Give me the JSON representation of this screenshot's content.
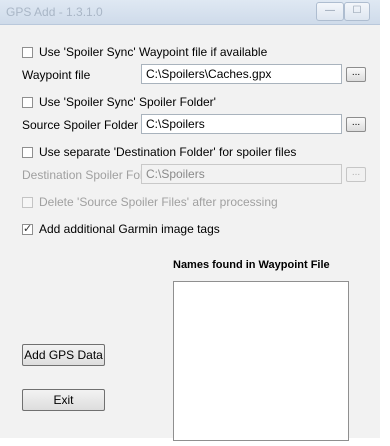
{
  "window": {
    "title": "GPS Add - 1.3.1.0",
    "minimize_glyph": "—",
    "maximize_glyph": "☐"
  },
  "options": {
    "use_spoiler_sync_waypoint": {
      "label": "Use 'Spoiler Sync' Waypoint file if available",
      "checked": false
    },
    "waypoint_file": {
      "label": "Waypoint file",
      "value": "C:\\Spoilers\\Caches.gpx",
      "browse": "..."
    },
    "use_spoiler_sync_folder": {
      "label": "Use 'Spoiler Sync' Spoiler Folder'",
      "checked": false
    },
    "source_spoiler_folder": {
      "label": "Source Spoiler Folder",
      "value": "C:\\Spoilers",
      "browse": "..."
    },
    "use_destination_folder": {
      "label": "Use separate 'Destination Folder' for spoiler files",
      "checked": false
    },
    "destination_spoiler_folder": {
      "label": "Destination Spoiler Folder",
      "value": "C:\\Spoilers",
      "browse": "...",
      "enabled": false
    },
    "delete_source_files": {
      "label": "Delete 'Source Spoiler Files' after processing",
      "checked": false,
      "enabled": false
    },
    "add_garmin_tags": {
      "label": "Add additional Garmin image tags",
      "checked": true
    }
  },
  "names_list": {
    "title": "Names found in Waypoint File",
    "items": []
  },
  "buttons": {
    "add_gps_data": "Add GPS Data",
    "exit": "Exit"
  }
}
